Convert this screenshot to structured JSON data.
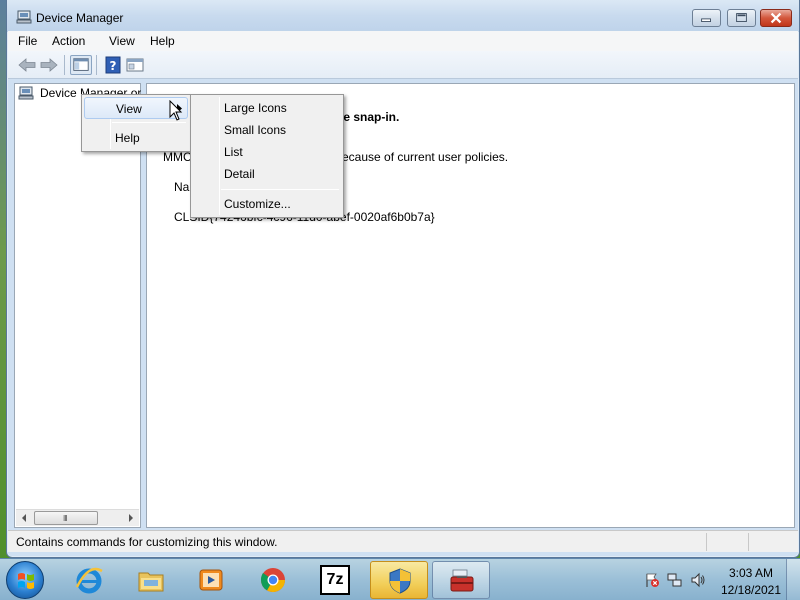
{
  "window": {
    "title": "Device Manager",
    "controls": {
      "minimize": "minimize",
      "maximize": "maximize",
      "close": "close"
    }
  },
  "menubar": {
    "items": [
      {
        "label": "File"
      },
      {
        "label": "Action"
      },
      {
        "label": "View"
      },
      {
        "label": "Help"
      }
    ]
  },
  "toolbar": {
    "buttons": [
      "back-arrow-icon",
      "forward-arrow-icon",
      "show-hide-console-tree-icon",
      "help-icon",
      "properties-icon"
    ]
  },
  "tree": {
    "root_label": "Device Manager or"
  },
  "content": {
    "line1": "he snap-in.",
    "line2_prefix": "MMC",
    "line2_suffix": "ecause of current user policies.",
    "line3": "Na",
    "line4": "CLSID{74246bfc-4c96-11d0-abef-0020af6b0b7a}"
  },
  "context_menu": {
    "items": [
      {
        "label": "View",
        "has_submenu": true,
        "highlighted": true
      },
      {
        "label": "Help",
        "has_submenu": false
      }
    ]
  },
  "view_submenu": {
    "items": [
      {
        "label": "Large Icons"
      },
      {
        "label": "Small Icons"
      },
      {
        "label": "List"
      },
      {
        "label": "Detail"
      },
      {
        "label": "Customize..."
      }
    ]
  },
  "statusbar": {
    "text": "Contains commands for customizing this window."
  },
  "scrollbar": {
    "grip": "III"
  },
  "taskbar": {
    "apps": [
      {
        "name": "internet-explorer-icon",
        "state": "pinned"
      },
      {
        "name": "file-explorer-icon",
        "state": "pinned"
      },
      {
        "name": "media-player-icon",
        "state": "pinned"
      },
      {
        "name": "chrome-icon",
        "state": "pinned"
      },
      {
        "name": "7zip-icon",
        "label": "7z",
        "state": "pinned"
      },
      {
        "name": "security-shield-icon",
        "state": "active"
      },
      {
        "name": "toolbox-icon",
        "state": "open"
      }
    ],
    "tray": [
      "action-center-flag-icon",
      "network-icon",
      "volume-icon"
    ],
    "clock": {
      "time": "3:03 AM",
      "date": "12/18/2021"
    }
  },
  "colors": {
    "accent": "#aecbf0",
    "window_frame": "#cfe0f2",
    "close_button": "#c1361a",
    "active_task": "#f2cf5a"
  }
}
